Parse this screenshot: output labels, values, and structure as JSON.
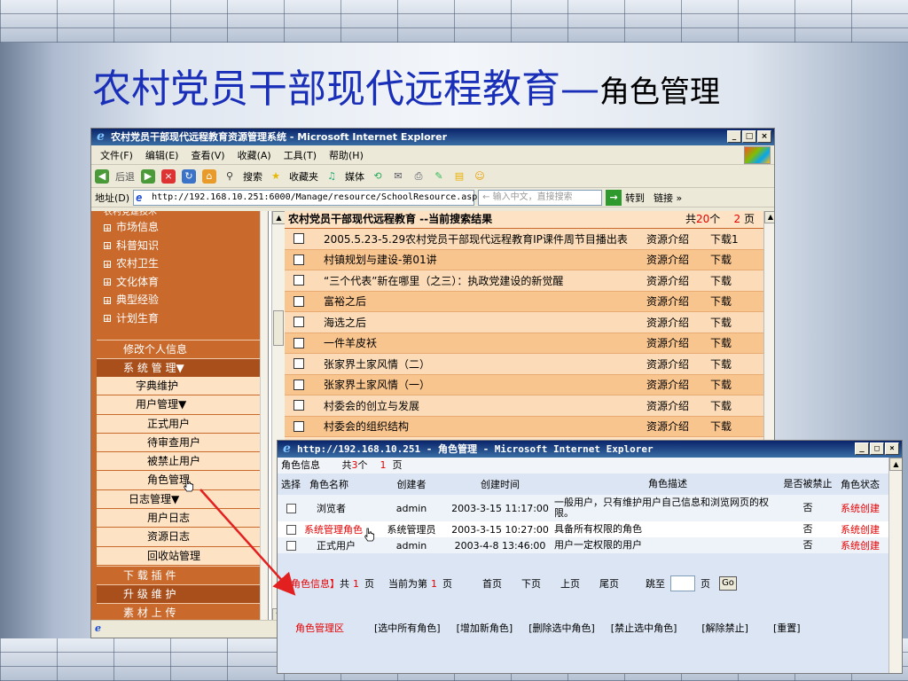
{
  "slide": {
    "title_main": "农村党员干部现代远程教育",
    "title_dash": "—",
    "title_sub": "角色管理"
  },
  "browser1": {
    "title": "农村党员干部现代远程教育资源管理系统 - Microsoft Internet Explorer",
    "menu": [
      "文件(F)",
      "编辑(E)",
      "查看(V)",
      "收藏(A)",
      "工具(T)",
      "帮助(H)"
    ],
    "toolbar": {
      "back": "后退",
      "search": "搜索",
      "favorites": "收藏夹",
      "media": "媒体"
    },
    "address": {
      "label": "地址(D)",
      "url": "http://192.168.10.251:6000/Manage/resource/SchoolResource.asp",
      "search_placeholder": "← 输入中文，直接搜索",
      "go": "转到",
      "links": "链接 »"
    },
    "sidebar": {
      "partial_item": "农村党建技术",
      "categories": [
        "市场信息",
        "科普知识",
        "农村卫生",
        "文化体育",
        "典型经验",
        "计划生育"
      ],
      "menu": [
        {
          "label": "修改个人信息",
          "level": "main"
        },
        {
          "label": "系 统 管 理▼",
          "level": "main-alt"
        },
        {
          "label": "字典维护",
          "level": "lvl1"
        },
        {
          "label": "用户管理▼",
          "level": "lvl1"
        },
        {
          "label": "正式用户",
          "level": "lvl2"
        },
        {
          "label": "待审查用户",
          "level": "lvl2"
        },
        {
          "label": "被禁止用户",
          "level": "lvl2"
        },
        {
          "label": "角色管理",
          "level": "lvl2"
        },
        {
          "label": "日志管理▼",
          "level": "lvl1b"
        },
        {
          "label": "用户日志",
          "level": "lvl2"
        },
        {
          "label": "资源日志",
          "level": "lvl2"
        },
        {
          "label": "回收站管理",
          "level": "lvl2"
        },
        {
          "label": "下 载 插 件",
          "level": "main"
        },
        {
          "label": "升 级 维 护",
          "level": "main-alt"
        },
        {
          "label": "素 材 上 传",
          "level": "main"
        }
      ]
    },
    "results": {
      "header": "农村党员干部现代远程教育 --当前搜索结果",
      "total_prefix": "共",
      "total_count": "20",
      "total_suffix": "个",
      "pages_count": "2",
      "pages_suffix": "页",
      "rows": [
        {
          "title": "2005.5.23-5.29农村党员干部现代远程教育IP课件周节目播出表",
          "intro": "资源介绍",
          "download": "下载1"
        },
        {
          "title": "村镇规划与建设-第01讲",
          "intro": "资源介绍",
          "download": "下载"
        },
        {
          "title": "“三个代表”新在哪里（之三）：执政党建设的新觉醒",
          "intro": "资源介绍",
          "download": "下载"
        },
        {
          "title": "富裕之后",
          "intro": "资源介绍",
          "download": "下载"
        },
        {
          "title": "海选之后",
          "intro": "资源介绍",
          "download": "下载"
        },
        {
          "title": "一件羊皮袄",
          "intro": "资源介绍",
          "download": "下载"
        },
        {
          "title": "张家界土家风情（二）",
          "intro": "资源介绍",
          "download": "下载"
        },
        {
          "title": "张家界土家风情（一）",
          "intro": "资源介绍",
          "download": "下载"
        },
        {
          "title": "村委会的创立与发展",
          "intro": "资源介绍",
          "download": "下载"
        },
        {
          "title": "村委会的组织结构",
          "intro": "资源介绍",
          "download": "下载"
        }
      ]
    }
  },
  "browser2": {
    "title": "http://192.168.10.251 - 角色管理 - Microsoft Internet Explorer",
    "info": {
      "label": "角色信息",
      "total_prefix": "共",
      "total_count": "3",
      "total_suffix": "个",
      "page": "1",
      "page_suffix": "页"
    },
    "columns": [
      "选择",
      "角色名称",
      "创建者",
      "创建时间",
      "角色描述",
      "是否被禁止",
      "角色状态"
    ],
    "rows": [
      {
        "name": "浏览者",
        "creator": "admin",
        "time": "2003-3-15 11:17:00",
        "desc": "一般用户，只有维护用户自己信息和浏览网页的权限。",
        "banned": "否",
        "status": "系统创建"
      },
      {
        "name": "系统管理角色",
        "creator": "系统管理员",
        "time": "2003-3-15 10:27:00",
        "desc": "具备所有权限的角色",
        "banned": "否",
        "status": "系统创建"
      },
      {
        "name": "正式用户",
        "creator": "admin",
        "time": "2003-4-8 13:46:00",
        "desc": "用户一定权限的用户",
        "banned": "否",
        "status": "系统创建"
      }
    ],
    "pager": {
      "label": "【角色信息】",
      "total_prefix": "共",
      "total_pages": "1",
      "page_unit": "页",
      "current_prefix": "当前为第",
      "current_page": "1",
      "first": "首页",
      "next": "下页",
      "prev": "上页",
      "last": "尾页",
      "jump": "跳至",
      "go": "Go"
    },
    "actions": {
      "zone": "角色管理区",
      "select_all": "[选中所有角色]",
      "add": "[增加新角色]",
      "delete": "[删除选中角色]",
      "ban": "[禁止选中角色]",
      "unban": "[解除禁止]",
      "reset": "[重置]"
    }
  },
  "colors": {
    "title_blue": "#1a2fb8",
    "menu_orange": "#c96a2c",
    "row_light": "#fcdcb8",
    "row_dark": "#f9c58f",
    "link_red": "#e60000",
    "pointer_red": "#e32020"
  },
  "icons": [
    "ie-logo",
    "back-icon",
    "forward-icon",
    "stop-icon",
    "refresh-icon",
    "home-icon",
    "search-icon",
    "favorites-icon",
    "media-icon",
    "history-icon",
    "hand-cursor-icon"
  ]
}
